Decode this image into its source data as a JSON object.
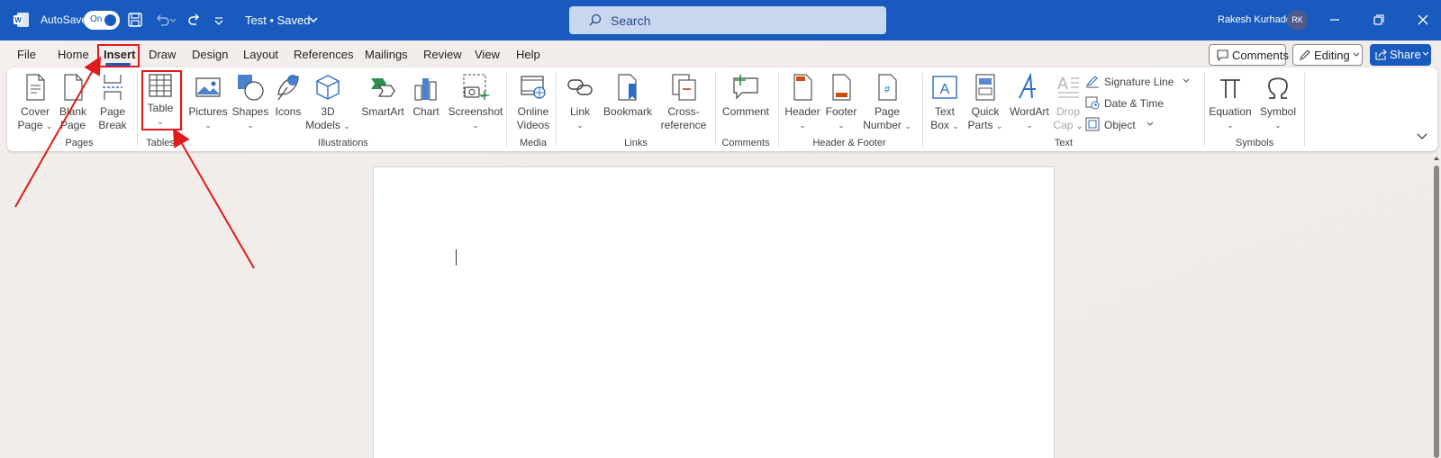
{
  "titlebar": {
    "autosave_label": "AutoSave",
    "autosave_state": "On",
    "doc_title": "Test • Saved",
    "search_placeholder": "Search",
    "user_name": "Rakesh Kurhade",
    "user_initials": "RK",
    "bar_color": "#185abd"
  },
  "tabs": [
    "File",
    "Home",
    "Insert",
    "Draw",
    "Design",
    "Layout",
    "References",
    "Mailings",
    "Review",
    "View",
    "Help"
  ],
  "active_tab": "Insert",
  "actions": {
    "comments": "Comments",
    "editing": "Editing",
    "share": "Share"
  },
  "ribbon": {
    "pages": {
      "label": "Pages",
      "cover": [
        "Cover",
        "Page"
      ],
      "blank": [
        "Blank",
        "Page"
      ],
      "break": [
        "Page",
        "Break"
      ]
    },
    "tables": {
      "label": "Tables",
      "table": "Table"
    },
    "illustrations": {
      "label": "Illustrations",
      "pictures": "Pictures",
      "shapes": "Shapes",
      "icons": "Icons",
      "models": [
        "3D",
        "Models"
      ],
      "smartart": "SmartArt",
      "chart": "Chart",
      "screenshot": "Screenshot"
    },
    "media": {
      "label": "Media",
      "online_videos": [
        "Online",
        "Videos"
      ]
    },
    "links": {
      "label": "Links",
      "link": "Link",
      "bookmark": "Bookmark",
      "cross_ref": [
        "Cross-",
        "reference"
      ]
    },
    "comments": {
      "label": "Comments",
      "comment": "Comment"
    },
    "header_footer": {
      "label": "Header & Footer",
      "header": "Header",
      "footer": "Footer",
      "page_number": [
        "Page",
        "Number"
      ]
    },
    "text": {
      "label": "Text",
      "text_box": [
        "Text",
        "Box"
      ],
      "quick_parts": [
        "Quick",
        "Parts"
      ],
      "wordart": "WordArt",
      "drop_cap": [
        "Drop",
        "Cap"
      ],
      "signature_line": "Signature Line",
      "date_time": "Date & Time",
      "object": "Object"
    },
    "symbols": {
      "label": "Symbols",
      "equation": "Equation",
      "symbol": "Symbol"
    }
  },
  "colors": {
    "accent": "#185abd",
    "annotation": "#e01b1b"
  }
}
